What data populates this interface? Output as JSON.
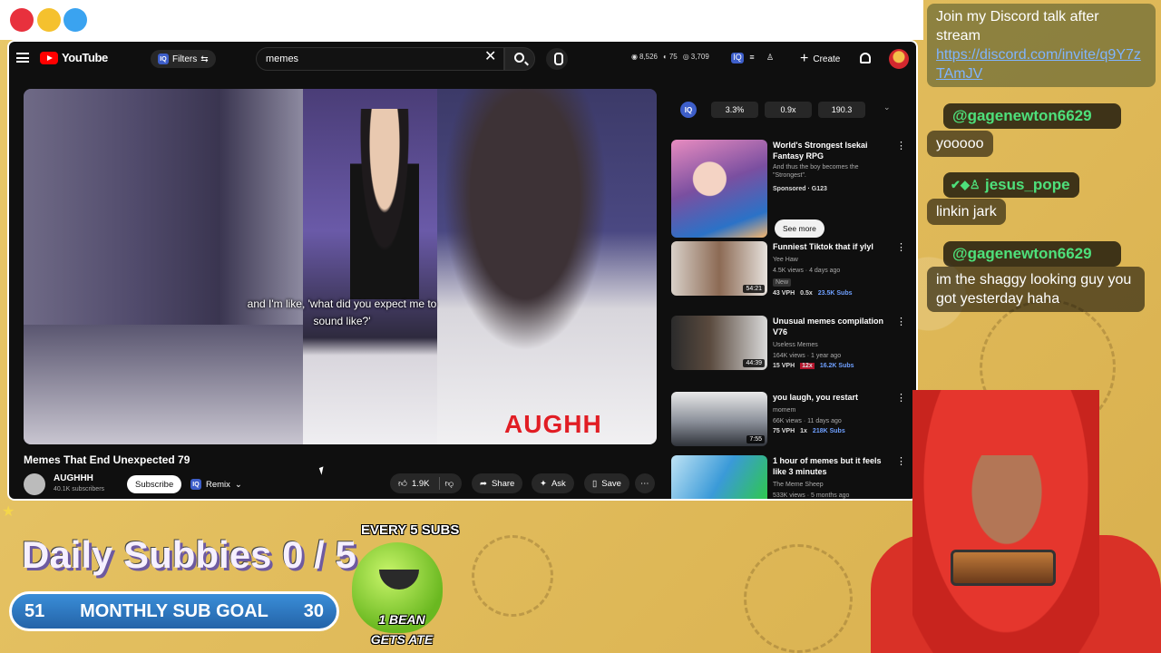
{
  "browser": {
    "colors": {
      "close": "#e8313d",
      "min": "#f5c12e",
      "max": "#3aa3f0"
    }
  },
  "header": {
    "logo_text": "YouTube",
    "filters_label": "Filters",
    "search_value": "memes",
    "stats": [
      "8,526",
      "75",
      "3,709"
    ],
    "create_label": "Create"
  },
  "player": {
    "caption": "and I'm like, 'what did you expect me to sound like?'",
    "watermark": "AUGHH"
  },
  "video": {
    "title": "Memes That End Unexpected 79",
    "channel": "AUGHHH",
    "subscribers": "40.1K subscribers",
    "subscribe_label": "Subscribe",
    "remix_label": "Remix",
    "likes": "1.9K",
    "share_label": "Share",
    "ask_label": "Ask",
    "save_label": "Save"
  },
  "speed_controls": {
    "chips": [
      "3.3%",
      "0.9x",
      "190.3"
    ]
  },
  "recommendations": [
    {
      "title": "World's Strongest Isekai Fantasy RPG",
      "desc": "And thus the boy becomes the \"Strongest\".",
      "meta": "Sponsored · G123",
      "cta": "See more"
    },
    {
      "title": "Funniest Tiktok that if ylyl",
      "channel": "Yee Haw",
      "meta": "4.5K views · 4 days ago",
      "tag": "New",
      "duration": "54:21",
      "chips": [
        "43 VPH",
        "0.5x",
        "23.5K Subs"
      ]
    },
    {
      "title": "Unusual memes compilation V76",
      "channel": "Useless Memes",
      "meta": "164K views · 1 year ago",
      "duration": "44:39",
      "chips": [
        "15 VPH",
        "12x",
        "16.2K Subs"
      ]
    },
    {
      "title": "you laugh, you restart",
      "channel": "momem",
      "meta": "66K views · 11 days ago",
      "duration": "7:55",
      "chips": [
        "75 VPH",
        "1x",
        "218K Subs"
      ]
    },
    {
      "title": "1 hour of memes but it feels like 3 minutes",
      "channel": "The Meme Sheep",
      "meta": "533K views · 5 months ago"
    }
  ],
  "chat": {
    "msg1": "Join my Discord talk after stream",
    "link": "https://discord.com/invite/q9Y7zTAmJV",
    "user1": "@gagenewton6629",
    "text1": "yooooo",
    "user2": "jesus_pope",
    "text2": "linkin jark",
    "user3": "@gagenewton6629",
    "text3": "im the shaggy looking guy you got yesterday haha"
  },
  "overlay": {
    "daily_title": "Daily Subbies 0 / 5",
    "goal_left": "51",
    "goal_label": "MONTHLY SUB GOAL",
    "goal_right": "30",
    "bean_top": "EVERY 5 SUBS",
    "bean_bottom": "1 BEAN GETS ATE"
  }
}
